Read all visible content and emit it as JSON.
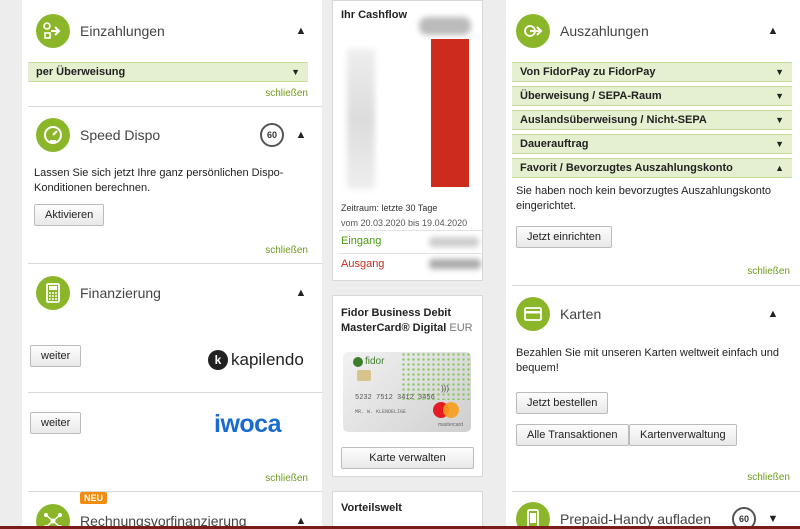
{
  "colors": {
    "accent": "#8cb62a",
    "link": "#6f9a1e",
    "danger": "#cc2b1d",
    "stripe": "#e4f0cf"
  },
  "left": {
    "einzahlungen": {
      "title": "Einzahlungen",
      "row": "per Überweisung",
      "close": "schließen",
      "icon": "deposit-arrow-icon"
    },
    "dispo": {
      "title": "Speed Dispo",
      "badge": "60",
      "text": "Lassen Sie sich jetzt Ihre ganz persönlichen Dispo-Konditionen berechnen.",
      "button": "Aktivieren",
      "close": "schließen",
      "icon": "speedometer-icon"
    },
    "finanzierung": {
      "title": "Finanzierung",
      "button1": "weiter",
      "logo1": "kapilendo",
      "button2": "weiter",
      "logo2": "iwoca",
      "close": "schließen",
      "icon": "calculator-icon"
    },
    "rechnung": {
      "title": "Rechnungsvorfinanzierung",
      "new_badge": "NEU",
      "icon": "network-icon"
    }
  },
  "mid": {
    "cashflow": {
      "title": "Ihr Cashflow",
      "period": "Zeitraum: letzte 30 Tage",
      "range": "vom 20.03.2020 bis 19.04.2020",
      "in_label": "Eingang",
      "out_label": "Ausgang"
    },
    "card": {
      "title": "Fidor Business Debit MasterCard® Digital",
      "currency": "EUR",
      "button": "Karte verwalten",
      "brand": "fidor",
      "network": "mastercard",
      "number": "5232 7512 3412 3456",
      "holder": "MR. W. KLENDELIGE"
    },
    "vorteil": {
      "title": "Vorteilswelt"
    }
  },
  "right": {
    "auszahlungen": {
      "title": "Auszahlungen",
      "icon": "withdraw-arrow-icon",
      "rows": [
        {
          "label": "Von FidorPay zu FidorPay",
          "open": false
        },
        {
          "label": "Überweisung / SEPA-Raum",
          "open": false
        },
        {
          "label": "Auslandsüberweisung / Nicht-SEPA",
          "open": false
        },
        {
          "label": "Dauerauftrag",
          "open": false
        },
        {
          "label": "Favorit / Bevorzugtes Auszahlungskonto",
          "open": true
        }
      ],
      "text": "Sie haben noch kein bevorzugtes Auszahlungskonto eingerichtet.",
      "button": "Jetzt einrichten",
      "close": "schließen"
    },
    "karten": {
      "title": "Karten",
      "icon": "card-icon",
      "text": "Bezahlen Sie mit unseren Karten weltweit einfach und bequem!",
      "button1": "Jetzt bestellen",
      "button2": "Alle Transaktionen",
      "button3": "Kartenverwaltung",
      "close": "schließen"
    },
    "prepaid": {
      "title": "Prepaid-Handy aufladen",
      "badge": "60",
      "icon": "phone-icon"
    }
  }
}
